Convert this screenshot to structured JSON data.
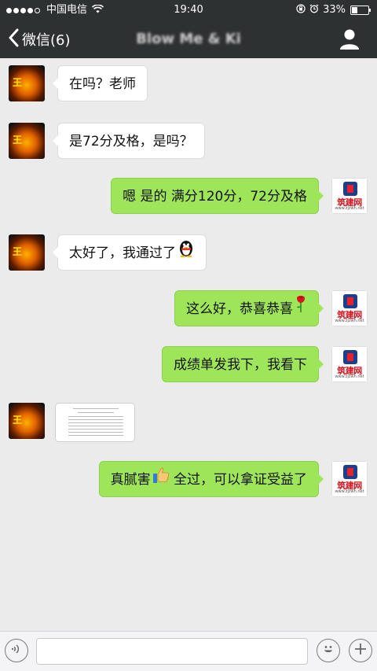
{
  "status_bar": {
    "carrier": "中国电信",
    "time": "19:40",
    "battery_percent": "33%",
    "battery_level": 0.33,
    "signal_bars": 4,
    "icons": [
      "signal-dots-icon",
      "wifi-icon",
      "orientation-lock-icon",
      "alarm-icon",
      "battery-icon"
    ]
  },
  "nav": {
    "back_label": "微信(6)",
    "title": "Blow Me & Ki",
    "icons": [
      "back-chevron-icon",
      "profile-icon"
    ]
  },
  "messages": [
    {
      "from": "other",
      "text": "在吗？老师"
    },
    {
      "from": "other",
      "text": "是72分及格，是吗？"
    },
    {
      "from": "me",
      "text": "嗯 是的 满分120分，72分及格"
    },
    {
      "from": "other",
      "text": "太好了，我通过了",
      "emoji": "penguin-emoji-icon"
    },
    {
      "from": "me",
      "text": "这么好，恭喜恭喜",
      "emoji": "rose-emoji-icon"
    },
    {
      "from": "me",
      "text": "成绩单发我下，我看下"
    },
    {
      "from": "other",
      "type": "image",
      "caption": "score-report-image"
    },
    {
      "from": "me",
      "parts": [
        "真腻害",
        " 全过，可以拿证受益了"
      ],
      "emoji": "thumbs-up-emoji-icon"
    }
  ],
  "avatars": {
    "other": {
      "glyph": "王",
      "desc": "tiger-avatar"
    },
    "me": {
      "brand": "筑建网",
      "url": "www.zjzwn.net"
    }
  },
  "composer": {
    "icons": [
      "voice-icon",
      "emoji-icon",
      "plus-icon"
    ],
    "placeholder": ""
  },
  "colors": {
    "header": "#2e3132",
    "chat_background": "#ebebeb",
    "bubble_out": "#9fe55a",
    "bubble_in": "#ffffff"
  }
}
